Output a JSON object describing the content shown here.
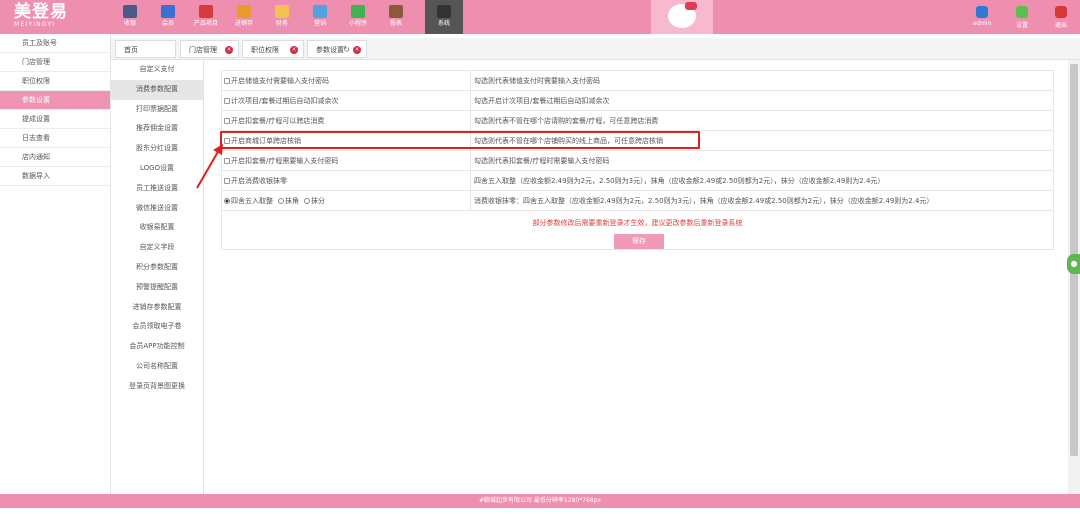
{
  "brand": {
    "name": "美登易",
    "sub": "MEIYINGYI"
  },
  "nav": [
    {
      "label": "收银",
      "icon": "register-icon",
      "color": "#4a5a8a"
    },
    {
      "label": "会员",
      "icon": "member-icon",
      "color": "#3b6fd1"
    },
    {
      "label": "产品项目",
      "icon": "product-icon",
      "color": "#d63a3a"
    },
    {
      "label": "进销存",
      "icon": "inventory-icon",
      "color": "#e99a2b"
    },
    {
      "label": "财务",
      "icon": "finance-icon",
      "color": "#f2c14e"
    },
    {
      "label": "营销",
      "icon": "marketing-icon",
      "color": "#4fa3e0"
    },
    {
      "label": "小程序",
      "icon": "miniprogram-icon",
      "color": "#3fb34f"
    },
    {
      "label": "报表",
      "icon": "report-icon",
      "color": "#8a5a3a"
    },
    {
      "label": "系统",
      "icon": "system-icon",
      "color": "#333333"
    }
  ],
  "top_right": [
    {
      "label": "admin",
      "icon": "user-icon",
      "color": "#2f79d6"
    },
    {
      "label": "设置",
      "icon": "settings-icon",
      "color": "#5bbf4c"
    },
    {
      "label": "退出",
      "icon": "logout-icon",
      "color": "#d93636"
    }
  ],
  "sidebar": [
    "员工及账号",
    "门店管理",
    "职位权限",
    "参数设置",
    "提成设置",
    "日志查看",
    "店内通知",
    "数据导入"
  ],
  "tabs": [
    "首页",
    "门店管理",
    "职位权限",
    "参数设置"
  ],
  "subnav": [
    "自定义支付",
    "消费参数配置",
    "打印票据配置",
    "推荐佣金设置",
    "股东分红设置",
    "LOGO设置",
    "员工推送设置",
    "微信推送设置",
    "收银易配置",
    "自定义字段",
    "积分参数配置",
    "预警提醒配置",
    "进销存参数配置",
    "会员领取电子卷",
    "会员APP功能控制",
    "公司名称配置",
    "登录页背景图更换"
  ],
  "params": [
    {
      "label": "开启储值支付需要输入支付密码",
      "desc": "勾选则代表储值支付时需要输入支付密码"
    },
    {
      "label": "计次项目/套餐过期后自动扣减余次",
      "desc": "勾选开启计次项目/套餐过期后自动扣减余次"
    },
    {
      "label": "开启扣套餐/疗程可以跨店消费",
      "desc": "勾选则代表不管在哪个店请购的套餐/疗程，可任意跨店消费"
    },
    {
      "label": "开启商城订单跨店核销",
      "desc": "勾选则代表不管在哪个店铺购买的线上商品，可任意跨店核销"
    },
    {
      "label": "开启扣套餐/疗程需要输入支付密码",
      "desc": "勾选则代表扣套餐/疗程时需要输入支付密码"
    },
    {
      "label": "开启消费收银抹零",
      "desc": "四舍五入取整（应收金额2.49则为2元，2.50则为3元），抹角（应收金额2.49或2.50则都为2元），抹分（应收金额2.49则为2.4元）"
    }
  ],
  "rounding": {
    "options": [
      "四舍五入取整",
      "抹角",
      "抹分"
    ],
    "selected": "四舍五入取整",
    "desc": "消费收银抹零：四舍五入取整（应收金额2.49则为2元，2.50则为3元），抹角（应收金额2.49或2.50则都为2元），抹分（应收金额2.49则为2.4元）"
  },
  "notice": "部分参数修改后需要重新登录才生效，建议更改参数后重新登录系统",
  "save_label": "保存",
  "footer": "#聊城起步有限公司    最低分辨率1280*768px",
  "colors": {
    "brand": "#ef8fb0",
    "highlight": "#e0201e",
    "notice": "#e03a3a"
  }
}
